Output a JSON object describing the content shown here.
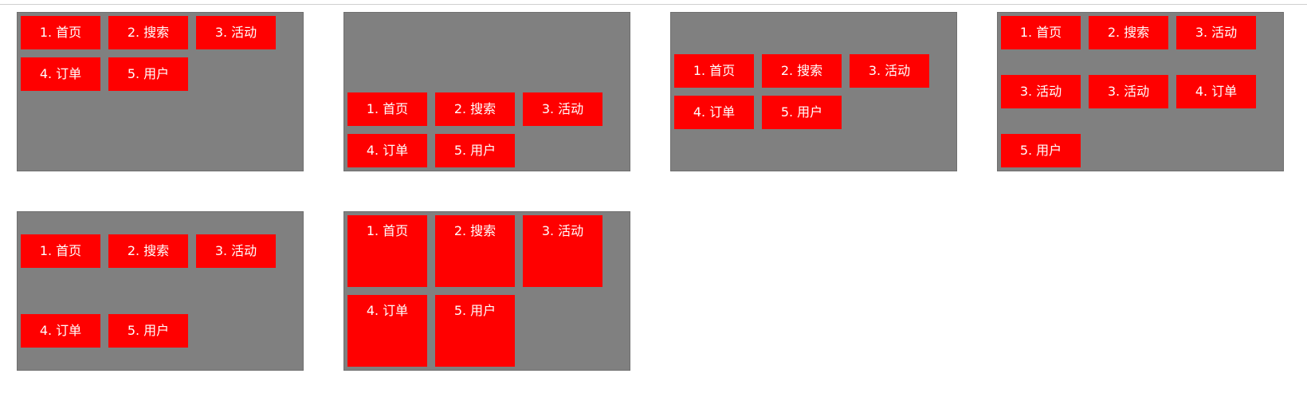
{
  "colors": {
    "panel_bg": "#808080",
    "tile_bg": "#ff0000",
    "tile_text": "#ffffff"
  },
  "panels": [
    {
      "items": [
        "1. 首页",
        "2. 搜索",
        "3. 活动",
        "4. 订单",
        "5. 用户"
      ]
    },
    {
      "items": [
        "1. 首页",
        "2. 搜索",
        "3. 活动",
        "4. 订单",
        "5. 用户"
      ]
    },
    {
      "items": [
        "1. 首页",
        "2. 搜索",
        "3. 活动",
        "4. 订单",
        "5. 用户"
      ]
    },
    {
      "items": [
        "1. 首页",
        "2. 搜索",
        "3. 活动",
        "3. 活动",
        "3. 活动",
        "4. 订单",
        "5. 用户"
      ]
    },
    {
      "items": [
        "1. 首页",
        "2. 搜索",
        "3. 活动",
        "4. 订单",
        "5. 用户"
      ]
    },
    {
      "items": [
        "1. 首页",
        "2. 搜索",
        "3. 活动",
        "4. 订单",
        "5. 用户"
      ]
    }
  ]
}
